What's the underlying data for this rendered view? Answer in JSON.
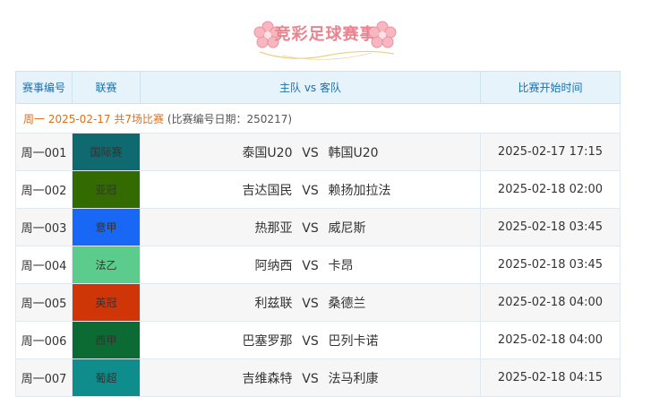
{
  "header": {
    "title": "竞彩足球赛事"
  },
  "table": {
    "columns": [
      "赛事编号",
      "联赛",
      "主队 vs 客队",
      "比赛开始时间"
    ],
    "date_header": {
      "day_label": "周一 2025-02-17 共7场比赛",
      "detail": "(比赛编号日期：250217)"
    },
    "vs_label": "VS",
    "rows": [
      {
        "code": "周一001",
        "league": "国际赛",
        "league_color": "#0e6a6e",
        "home": "泰国U20",
        "away": "韩国U20",
        "time": "2025-02-17 17:15"
      },
      {
        "code": "周一002",
        "league": "亚冠",
        "league_color": "#336b00",
        "home": "吉达国民",
        "away": "赖扬加拉法",
        "time": "2025-02-18 02:00"
      },
      {
        "code": "周一003",
        "league": "意甲",
        "league_color": "#1967f5",
        "home": "热那亚",
        "away": "威尼斯",
        "time": "2025-02-18 03:45"
      },
      {
        "code": "周一004",
        "league": "法乙",
        "league_color": "#5ccc8d",
        "home": "阿纳西",
        "away": "卡昂",
        "time": "2025-02-18 03:45"
      },
      {
        "code": "周一005",
        "league": "英冠",
        "league_color": "#cf3506",
        "home": "利兹联",
        "away": "桑德兰",
        "time": "2025-02-18 04:00"
      },
      {
        "code": "周一006",
        "league": "西甲",
        "league_color": "#0b6b32",
        "home": "巴塞罗那",
        "away": "巴列卡诺",
        "time": "2025-02-18 04:00"
      },
      {
        "code": "周一007",
        "league": "葡超",
        "league_color": "#0f8c8c",
        "home": "吉维森特",
        "away": "法马利康",
        "time": "2025-02-18 04:15"
      }
    ]
  }
}
